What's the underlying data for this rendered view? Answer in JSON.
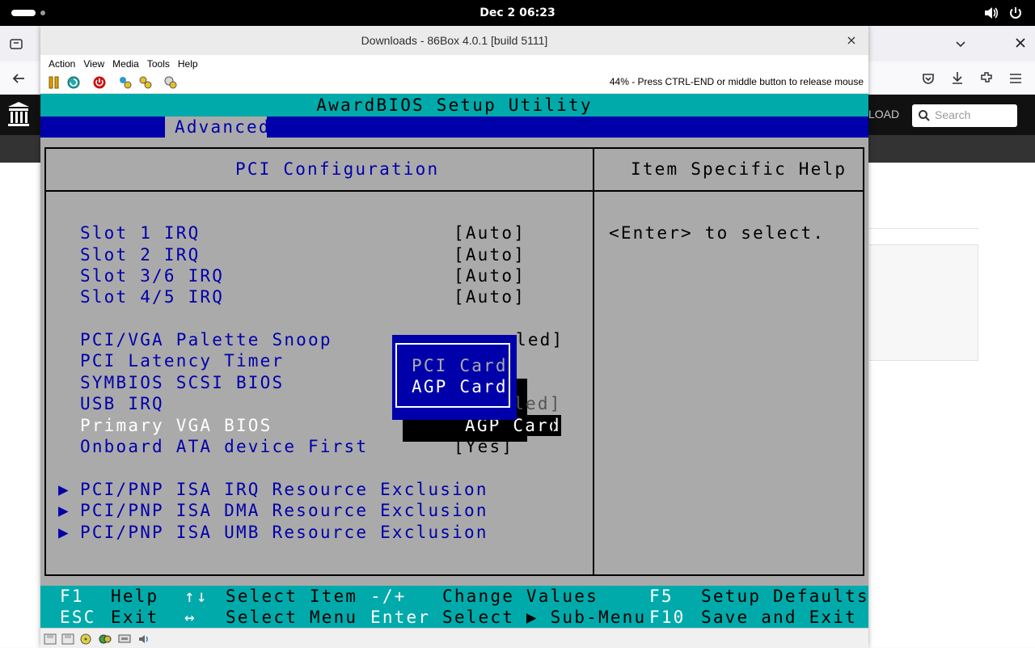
{
  "topbar": {
    "clock": "Dec 2  06:23"
  },
  "browser": {
    "search_placeholder": "Search",
    "upload_fragment": "LOAD"
  },
  "window": {
    "title": "Downloads - 86Box 4.0.1 [build 5111]",
    "close_glyph": "×",
    "menu": [
      "Action",
      "View",
      "Media",
      "Tools",
      "Help"
    ],
    "status_message": "44% - Press CTRL-END or middle button to release mouse"
  },
  "bios": {
    "utility_title": "AwardBIOS Setup Utility",
    "active_tab": "Advanced",
    "section_title": "PCI Configuration",
    "help_title": "Item Specific Help",
    "help_text": "<Enter> to select.",
    "items": [
      {
        "label": "Slot 1 IRQ",
        "value": "[Auto]"
      },
      {
        "label": "Slot 2 IRQ",
        "value": "[Auto]"
      },
      {
        "label": "Slot 3/6 IRQ",
        "value": "[Auto]"
      },
      {
        "label": "Slot 4/5 IRQ",
        "value": "[Auto]"
      },
      {
        "label": "PCI/VGA Palette Snoop",
        "value": "led]"
      },
      {
        "label": "PCI Latency Timer",
        "value": ""
      },
      {
        "label": "SYMBIOS SCSI BIOS",
        "value": ""
      },
      {
        "label": "USB IRQ",
        "value": "[Enabled]"
      },
      {
        "label": "Primary VGA BIOS",
        "value": "AGP Card"
      },
      {
        "label": "Onboard ATA device First",
        "value": "[Yes]"
      }
    ],
    "selected_value_bracket_left": "[",
    "selected_value_bracket_right": "]",
    "submenus": [
      "PCI/PNP ISA IRQ Resource Exclusion",
      "PCI/PNP ISA DMA Resource Exclusion",
      "PCI/PNP ISA UMB Resource Exclusion"
    ],
    "submenu_marker": "▶",
    "popup_options": [
      "PCI Card",
      "AGP Card"
    ],
    "footer": {
      "row1": [
        {
          "key": "F1",
          "desc": "Help"
        },
        {
          "key": "↑↓",
          "desc": "Select Item"
        },
        {
          "key": "-/+",
          "desc": "Change Values"
        },
        {
          "key": "F5",
          "desc": "Setup Defaults"
        }
      ],
      "row2": [
        {
          "key": "ESC",
          "desc": "Exit"
        },
        {
          "key": "↔",
          "desc": "Select Menu"
        },
        {
          "key": "Enter",
          "desc": "Select ▶ Sub-Menu"
        },
        {
          "key": "F10",
          "desc": "Save and Exit"
        }
      ]
    }
  }
}
